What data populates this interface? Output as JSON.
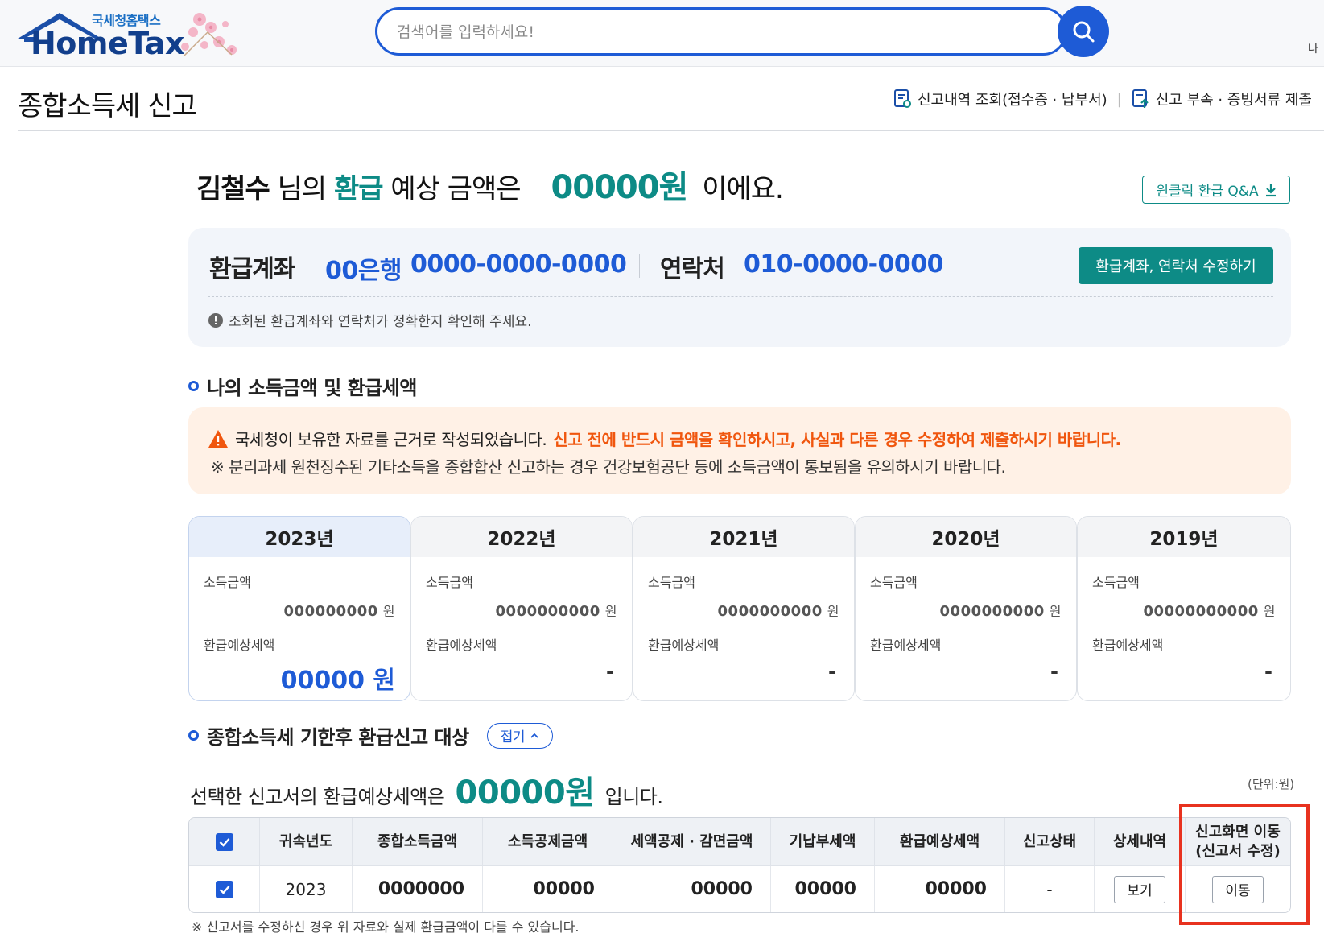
{
  "header": {
    "logo_sub": "국세청홈택스",
    "logo_main": "HomeTax",
    "search_placeholder": "검색어를 입력하세요!",
    "top_right_text": "나"
  },
  "page": {
    "title": "종합소득세 신고",
    "link_history": "신고내역 조회(접수증 · 납부서)",
    "link_attach": "신고 부속 · 증빙서류 제출"
  },
  "hero": {
    "name": "김철수",
    "part1": "님의",
    "refund_word": "환급",
    "part2": "예상 금액은",
    "amount": "00000원",
    "part3": "이에요.",
    "qa_button": "원클릭 환급 Q&A"
  },
  "account": {
    "account_label": "환급계좌",
    "bank": "00은행",
    "account_number": "0000-0000-0000",
    "contact_label": "연락처",
    "phone": "010-0000-0000",
    "edit_button": "환급계좌, 연락처 수정하기",
    "note": "조회된 환급계좌와 연락처가 정확한지 확인해 주세요."
  },
  "income_section": {
    "heading": "나의 소득금액 및 환급세액",
    "warning_normal": "국세청이 보유한 자료를 근거로 작성되었습니다.",
    "warning_emphasis": "신고 전에 반드시 금액을 확인하시고, 사실과 다른 경우 수정하여 제출하시기 바랍니다.",
    "warning_note": "※ 분리과세 원천징수된 기타소득을 종합합산 신고하는 경우 건강보험공단 등에 소득금액이 통보됨을 유의하시기 바랍니다.",
    "income_label": "소득금액",
    "refund_label": "환급예상세액",
    "won": "원",
    "years": [
      {
        "year": "2023년",
        "income": "000000000",
        "refund": "00000 원"
      },
      {
        "year": "2022년",
        "income": "0000000000",
        "refund": "-"
      },
      {
        "year": "2021년",
        "income": "0000000000",
        "refund": "-"
      },
      {
        "year": "2020년",
        "income": "0000000000",
        "refund": "-"
      },
      {
        "year": "2019년",
        "income": "00000000000",
        "refund": "-"
      }
    ]
  },
  "late_section": {
    "heading": "종합소득세 기한후 환급신고 대상",
    "fold_button": "접기",
    "selected_prefix": "선택한 신고서의 환급예상세액은",
    "selected_amount": "00000원",
    "selected_suffix": "입니다.",
    "unit_note": "(단위:원)",
    "columns": [
      "귀속년도",
      "종합소득금액",
      "소득공제금액",
      "세액공제 · 감면금액",
      "기납부세액",
      "환급예상세액",
      "신고상태",
      "상세내역"
    ],
    "move_column_line1": "신고화면 이동",
    "move_column_line2": "(신고서 수정)",
    "row": {
      "year": "2023",
      "total_income": "0000000",
      "deduction": "00000",
      "tax_credit": "00000",
      "prepaid": "00000",
      "refund": "00000",
      "status": "-",
      "detail_button": "보기",
      "move_button": "이동"
    },
    "footnote": "※ 신고서를 수정하신 경우 위 자료와 실제 환급금액이 다를 수 있습니다."
  },
  "colors": {
    "primary_blue": "#1e5bd6",
    "teal": "#0d8b86",
    "warning_orange": "#f0560e",
    "highlight_red": "#e8321f"
  }
}
